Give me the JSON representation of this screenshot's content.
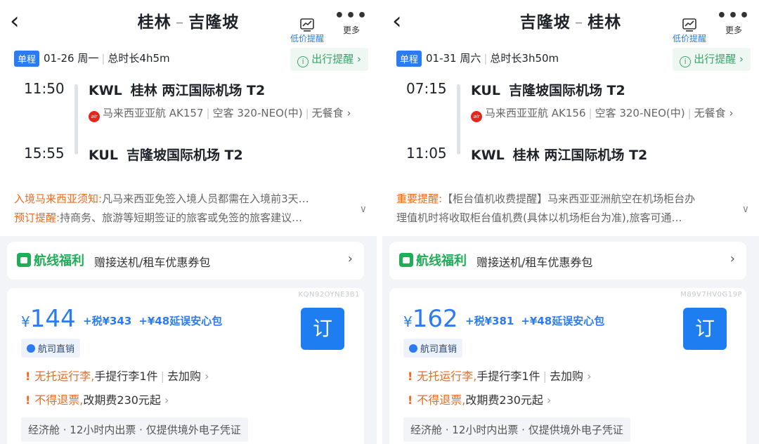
{
  "panels": [
    {
      "title_from": "桂林",
      "title_dash": "–",
      "title_to": "吉隆坡",
      "price_alert": "低价提醒",
      "more": "更多",
      "trip_type": "单程",
      "date": "01-26 周一",
      "duration": "总时长4h5m",
      "travel_remind": "出行提醒",
      "dep_time": "11:50",
      "dep_code": "KWL",
      "dep_airport": "桂林 两江国际机场 T2",
      "airline": "马来西亚亚航 AK157",
      "aircraft": "空客 320-NEO(中)",
      "meal": "无餐食",
      "arr_time": "15:55",
      "arr_code": "KUL",
      "arr_airport": "吉隆坡国际机场 T2",
      "notice1_label": "入境马来西亚须知:",
      "notice1_text": "凡马来西亚免签入境人员都需在入境前3天…",
      "notice2_label": "预订提醒:",
      "notice2_text": "持商务、旅游等短期签证的旅客或免签的旅客建议…",
      "benefit_title": "航线福利",
      "benefit_desc": "赠接送机/租车优惠券包",
      "product_code": "KQN92OYNE3B1",
      "yen": "¥",
      "price": "144",
      "tax": "+税¥343",
      "delay_pack": "+¥48延误安心包",
      "book": "订",
      "direct_sale": "航司直销",
      "rule1_orange": "无托运行李,",
      "rule1_text": "手提行李1件",
      "rule1_link": "去加购",
      "rule2_orange": "不得退票,",
      "rule2_text": "改期费230元起",
      "cabin": "经济舱 · 12小时内出票 · 仅提供境外电子凭证"
    },
    {
      "title_from": "吉隆坡",
      "title_dash": "–",
      "title_to": "桂林",
      "price_alert": "低价提醒",
      "more": "更多",
      "trip_type": "单程",
      "date": "01-31 周六",
      "duration": "总时长3h50m",
      "travel_remind": "出行提醒",
      "dep_time": "07:15",
      "dep_code": "KUL",
      "dep_airport": "吉隆坡国际机场 T2",
      "airline": "马来西亚亚航 AK156",
      "aircraft": "空客 320-NEO(中)",
      "meal": "无餐食",
      "arr_time": "11:05",
      "arr_code": "KWL",
      "arr_airport": "桂林 两江国际机场 T2",
      "notice1_label": "重要提醒:",
      "notice1_text": "【柜台值机收费提醒】马来西亚亚洲航空在机场柜台办",
      "notice2_label": "",
      "notice2_text": "理值机时将收取柜台值机费(具体以机场柜台为准),旅客可通…",
      "benefit_title": "航线福利",
      "benefit_desc": "赠接送机/租车优惠券包",
      "product_code": "M89V7HV0G19P",
      "yen": "¥",
      "price": "162",
      "tax": "+税¥381",
      "delay_pack": "+¥48延误安心包",
      "book": "订",
      "direct_sale": "航司直销",
      "rule1_orange": "无托运行李,",
      "rule1_text": "手提行李1件",
      "rule1_link": "去加购",
      "rule2_orange": "不得退票,",
      "rule2_text": "改期费230元起",
      "cabin": "经济舱 · 12小时内出票 · 仅提供境外电子凭证"
    }
  ],
  "colors": {
    "accent": "#2a7bf4",
    "orange": "#f06a1f",
    "green": "#1fad58"
  },
  "icons": [
    "back-icon",
    "price-alert-icon",
    "more-icon",
    "info-icon",
    "airasia-logo",
    "chevron-down-icon",
    "benefit-icon",
    "chevron-right-icon",
    "direct-sale-icon",
    "warning-icon"
  ]
}
